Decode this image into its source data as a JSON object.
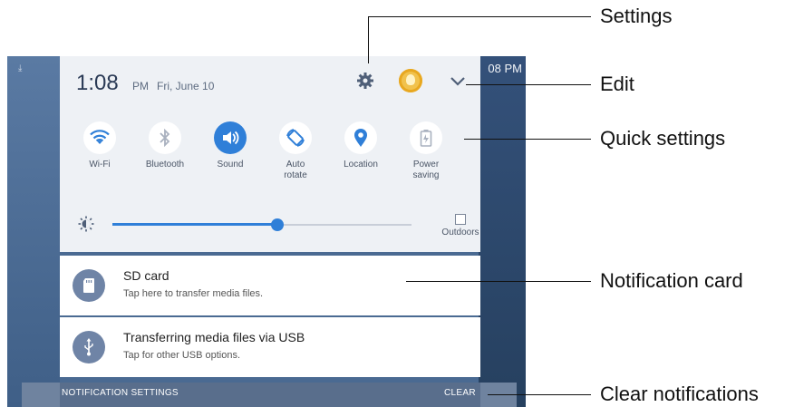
{
  "status_bar": {
    "right_time": "08 PM"
  },
  "panel": {
    "time": "1:08",
    "ampm": "PM",
    "date": "Fri, June 10",
    "quick_settings": [
      {
        "label": "Wi-Fi",
        "icon": "wifi-icon",
        "active": true
      },
      {
        "label": "Bluetooth",
        "icon": "bluetooth-icon",
        "active": false
      },
      {
        "label": "Sound",
        "icon": "sound-icon",
        "active": true
      },
      {
        "label": "Auto\nrotate",
        "icon": "auto-rotate-icon",
        "active": true
      },
      {
        "label": "Location",
        "icon": "location-icon",
        "active": true
      },
      {
        "label": "Power\nsaving",
        "icon": "power-saving-icon",
        "active": false
      }
    ],
    "brightness_level": 0.55,
    "outdoors_label": "Outdoors"
  },
  "notifications": [
    {
      "title": "SD card",
      "subtitle": "Tap here to transfer media files.",
      "icon": "sd-card-icon"
    },
    {
      "title": "Transferring media files via USB",
      "subtitle": "Tap for other USB options.",
      "icon": "usb-icon"
    }
  ],
  "bottom_bar": {
    "settings_label": "NOTIFICATION SETTINGS",
    "clear_label": "CLEAR"
  },
  "callouts": {
    "settings": "Settings",
    "edit": "Edit",
    "quick_settings": "Quick settings",
    "notification_card": "Notification card",
    "clear_notifications": "Clear notifications"
  },
  "colors": {
    "accent": "#2f7fd8",
    "inactive": "#b8c0cc",
    "panel_bg": "#eef1f5",
    "wallpaper": "#4a6a92"
  }
}
